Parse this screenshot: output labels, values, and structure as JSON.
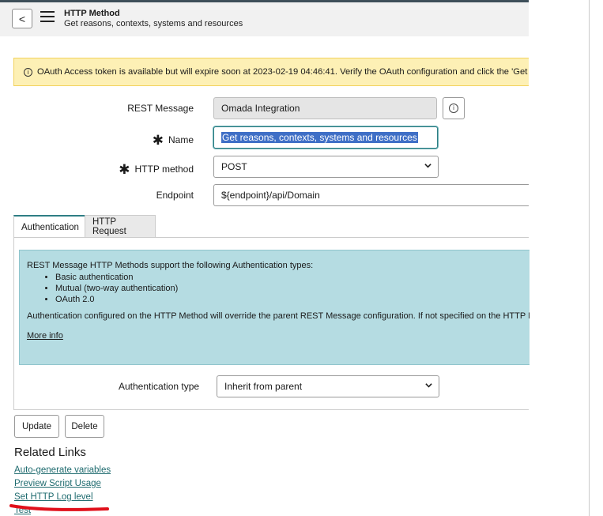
{
  "header": {
    "back_label": "<",
    "title": "HTTP Method",
    "subtitle": "Get reasons, contexts, systems and resources"
  },
  "banner": {
    "icon": "info-circle-icon",
    "text": "OAuth Access token is available but will expire soon at 2023-02-19 04:46:41. Verify the OAuth configuration and click the 'Get OAu"
  },
  "form": {
    "rest_message": {
      "label": "REST Message",
      "value": "Omada Integration"
    },
    "name": {
      "label": "Name",
      "value": "Get reasons, contexts, systems and resources"
    },
    "http_method": {
      "label": "HTTP method",
      "value": "POST"
    },
    "endpoint": {
      "label": "Endpoint",
      "value": "${endpoint}/api/Domain"
    },
    "required_mark": "✱"
  },
  "tabs": [
    {
      "label": "Authentication",
      "active": true
    },
    {
      "label": "HTTP Request",
      "active": false
    }
  ],
  "auth_notice": {
    "intro": "REST Message HTTP Methods support the following Authentication types:",
    "items": [
      "Basic authentication",
      "Mutual (two-way authentication)",
      "OAuth 2.0"
    ],
    "override": "Authentication configured on the HTTP Method will override the parent REST Message configuration. If not specified on the HTTP M",
    "more_info": "More info"
  },
  "auth_type": {
    "label": "Authentication type",
    "value": "Inherit from parent"
  },
  "buttons": {
    "update": "Update",
    "delete": "Delete"
  },
  "related_links": {
    "title": "Related Links",
    "links": [
      "Auto-generate variables",
      "Preview Script Usage",
      "Set HTTP Log level",
      "Test"
    ]
  },
  "colors": {
    "accent": "#2f7e84",
    "banner_bg": "#fdf0b5",
    "notice_bg": "#b5dce2",
    "link": "#1f6b6f",
    "annotation": "#e0101b"
  }
}
